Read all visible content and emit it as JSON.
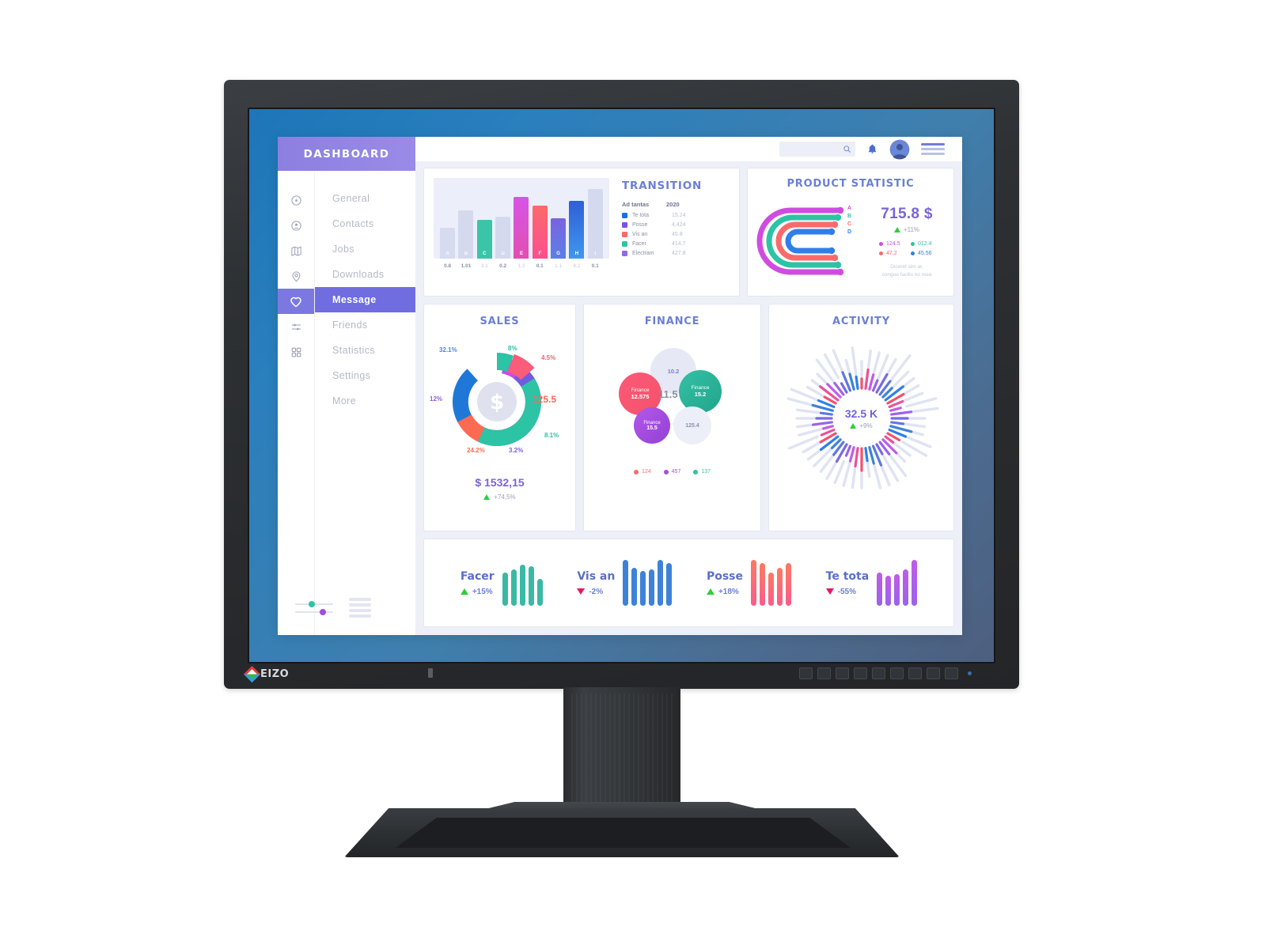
{
  "monitor": {
    "brand": "EIZO"
  },
  "sidebar": {
    "brand": "DASHBOARD",
    "items": [
      {
        "label": "General",
        "icon": "target-icon"
      },
      {
        "label": "Contacts",
        "icon": "user-circle-icon"
      },
      {
        "label": "Jobs",
        "icon": "map-icon"
      },
      {
        "label": "Downloads",
        "icon": "location-pin-icon"
      },
      {
        "label": "Message",
        "icon": "heart-icon",
        "active": true
      },
      {
        "label": "Friends",
        "icon": "sliders-icon"
      },
      {
        "label": "Statistics",
        "icon": "grid-icon"
      },
      {
        "label": "Settings",
        "icon": ""
      },
      {
        "label": "More",
        "icon": ""
      }
    ]
  },
  "topbar": {
    "search_placeholder": "",
    "search_value": "",
    "icons": [
      "search-icon",
      "bell-icon",
      "avatar-icon",
      "menu-icon"
    ]
  },
  "chart_data": [
    {
      "type": "bar",
      "title": "TRANSITION",
      "categories": [
        "A",
        "B",
        "C",
        "D",
        "E",
        "F",
        "G",
        "H",
        "I"
      ],
      "values": [
        38,
        60,
        48,
        52,
        76,
        66,
        50,
        72,
        84
      ],
      "tick_labels": [
        "0.8",
        "1.01",
        "3.1",
        "0.2",
        "1.3",
        "0.1",
        "1.1",
        "4.2",
        "0.1"
      ],
      "colors": [
        "#d7dbef",
        "#d7dbef",
        "#3ac4a8",
        "#d7dbef",
        "#d655e8",
        "#fb6a6a",
        "#7b63e0",
        "#2f7fe8",
        "#d7dbef"
      ],
      "legend_headers": [
        "Ad tantas",
        "2020"
      ],
      "legend": [
        {
          "name": "Te tota",
          "value": "15.24",
          "color": "#1f6fe0"
        },
        {
          "name": "Posse",
          "value": "4,424",
          "color": "#7b4fe8"
        },
        {
          "name": "Vis an",
          "value": "45.8",
          "color": "#fb6a6a"
        },
        {
          "name": "Facer",
          "value": "414.7",
          "color": "#2dc3a5"
        },
        {
          "name": "Electram",
          "value": "427.8",
          "color": "#8f6ae8"
        }
      ],
      "xlabel": "",
      "ylabel": "",
      "grid": false,
      "legend_position": "right"
    },
    {
      "type": "bar",
      "title": "PRODUCT STATISTIC",
      "orientation": "rounded-nested-arcs",
      "categories": [
        "A",
        "B",
        "C",
        "D"
      ],
      "values": [
        124.5,
        12.4,
        47.2,
        45.56
      ],
      "colors": [
        "#d04ce0",
        "#2dc3a5",
        "#fb6a6a",
        "#2f7fe8"
      ],
      "total": "715.8 $",
      "delta": "+11%",
      "delta_dir": "up",
      "metrics": [
        {
          "value": "124.5",
          "color": "#d04ce0"
        },
        {
          "value": "012.4",
          "color": "#2dc3a5"
        },
        {
          "value": "47.2",
          "color": "#fb6a6a"
        },
        {
          "value": "45.56",
          "color": "#2f7fe8"
        }
      ],
      "caption_line1": "Diceret sim at,",
      "caption_line2": "congue facilis no mea"
    },
    {
      "type": "pie",
      "title": "SALES",
      "labels": [
        "32.1%",
        "8%",
        "4.5%",
        "8.1%",
        "3.2%",
        "24.2%",
        "12%"
      ],
      "values": [
        32.1,
        8,
        4.5,
        8.1,
        3.2,
        24.2,
        12
      ],
      "colors": [
        "#1f78d8",
        "#2dc3a5",
        "#fb5c7a",
        "#2dc3a5",
        "#6f5ce0",
        "#fb6a52",
        "#c84ce8"
      ],
      "center_icon": "dollar-icon",
      "side_value": "125.5",
      "total": "1532,15",
      "currency": "$",
      "delta": "+74,5%",
      "delta_dir": "up"
    },
    {
      "type": "scatter",
      "title": "FINANCE",
      "center_value": "11.5",
      "bubbles": [
        {
          "label": "",
          "value": "10.2",
          "color": "#e6e9f5",
          "text_color": "#7b7fd0"
        },
        {
          "label": "Finance",
          "value": "12.575",
          "color": "#f4516c",
          "text_color": "#ffffff"
        },
        {
          "label": "Finance",
          "value": "15.2",
          "color": "#2dae96",
          "text_color": "#ffffff"
        },
        {
          "label": "Finance",
          "value": "15.5",
          "color": "#a34de0",
          "text_color": "#ffffff"
        },
        {
          "label": "",
          "value": "125.4",
          "color": "#eceff8",
          "text_color": "#8b90ad"
        }
      ],
      "legend": [
        {
          "value": "124",
          "color": "#fb6a6a"
        },
        {
          "value": "457",
          "color": "#a34de0"
        },
        {
          "value": "137",
          "color": "#2dc3a5"
        }
      ]
    },
    {
      "type": "bar",
      "title": "ACTIVITY",
      "orientation": "radial",
      "center_value": "32.5 K",
      "delta": "+9%",
      "delta_dir": "up",
      "spokes": 48
    },
    {
      "type": "bar",
      "title": "",
      "groups": [
        {
          "name": "Facer",
          "delta": "+15%",
          "dir": "up",
          "color": "#3ab9a4",
          "values": [
            42,
            46,
            52,
            50,
            34
          ]
        },
        {
          "name": "Vis an",
          "delta": "-2%",
          "dir": "down",
          "color": "#3d82d8",
          "values": [
            58,
            48,
            44,
            46,
            58,
            54
          ]
        },
        {
          "name": "Posse",
          "delta": "+18%",
          "dir": "up",
          "color": "#fb6a72",
          "values": [
            58,
            54,
            42,
            48,
            54
          ]
        },
        {
          "name": "Te tota",
          "delta": "-55%",
          "dir": "down",
          "color": "#b764e8",
          "values": [
            42,
            38,
            40,
            46,
            58
          ]
        }
      ]
    }
  ],
  "colors": {
    "brand_purple": "#8b7fe0",
    "active_nav": "#6f6de0",
    "title_blue": "#6b7fd7",
    "up_green": "#2fcc3e",
    "down_pink": "#e8185c",
    "screen_bg": "#2a7fbd"
  }
}
